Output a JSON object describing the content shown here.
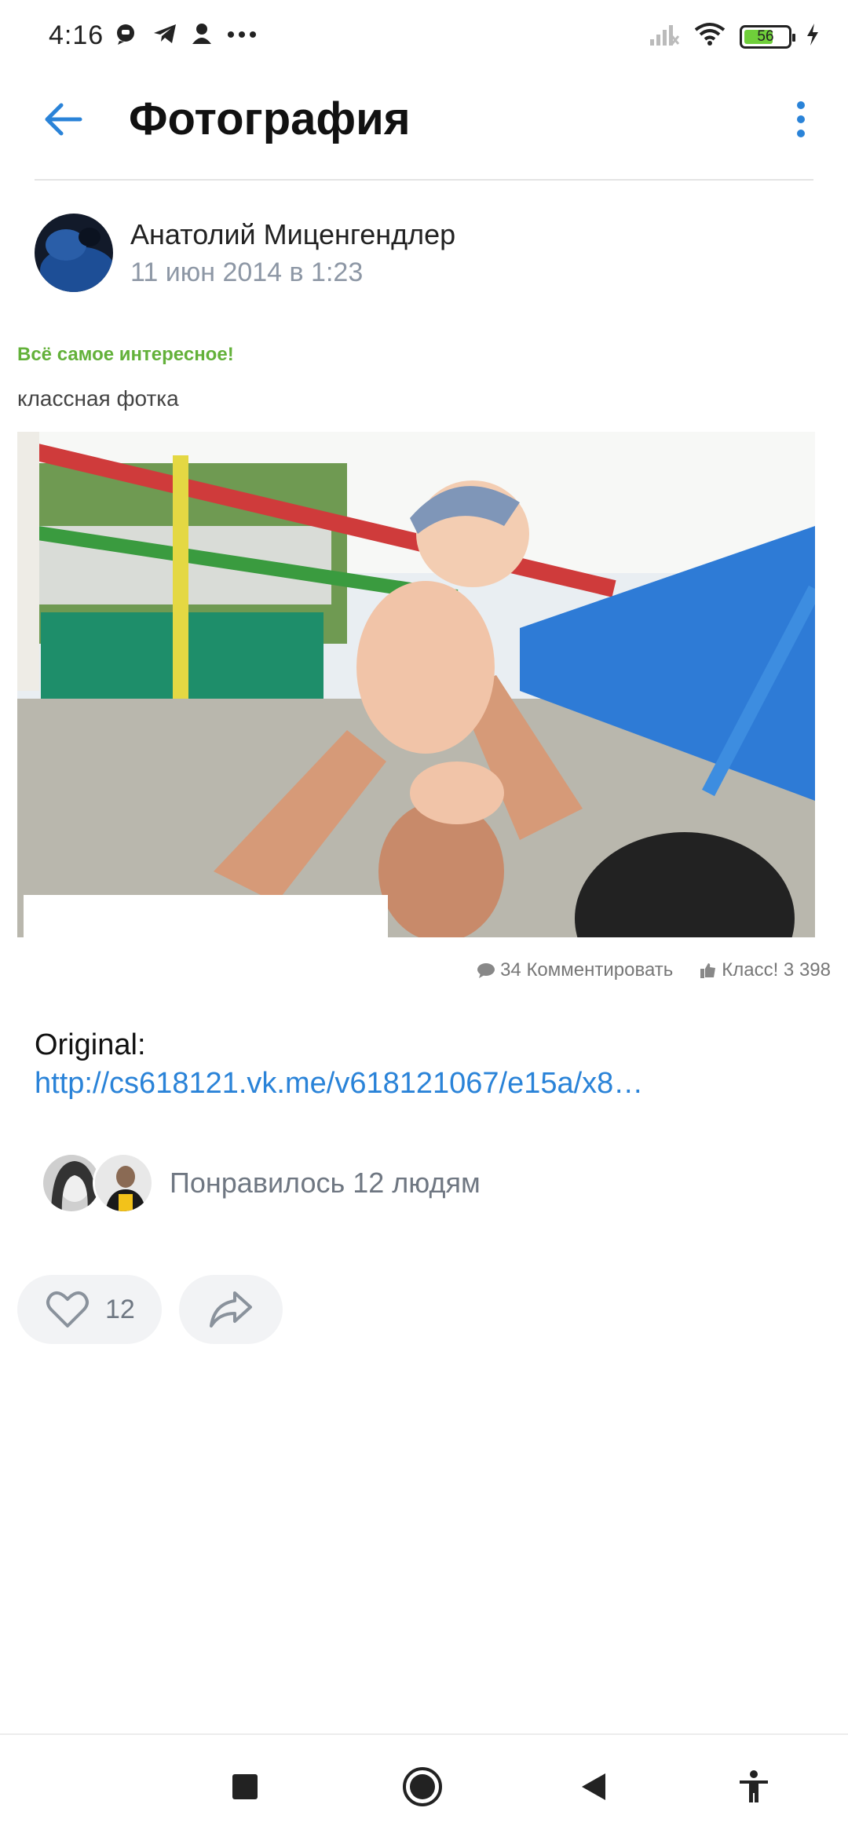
{
  "status_bar": {
    "time": "4:16",
    "battery": "56"
  },
  "app_bar": {
    "title": "Фотография"
  },
  "post": {
    "author_name": "Анатолий Миценгендлер",
    "date": "11 июн 2014 в 1:23",
    "promo": "Всё самое интересное!",
    "caption": "классная фотка",
    "comments": "34 Комментировать",
    "klass": "Класс! 3 398",
    "original_label": "Original:",
    "original_link": "http://cs618121.vk.me/v618121067/e15a/x8…"
  },
  "likes": {
    "text": "Понравилось 12 людям"
  },
  "actions": {
    "like_count": "12"
  },
  "colors": {
    "accent": "#2a83d8",
    "promo": "#63b13a",
    "muted": "#8d97a5"
  }
}
